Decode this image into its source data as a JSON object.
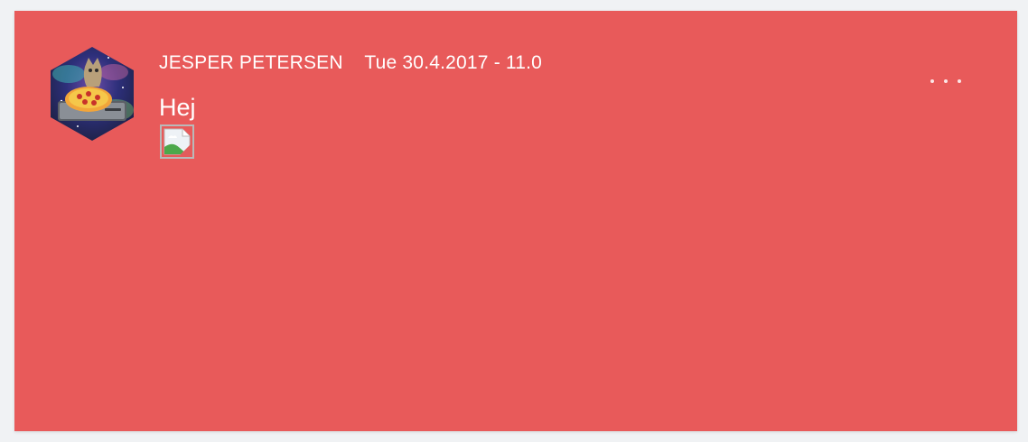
{
  "post": {
    "author": "JESPER PETERSEN",
    "timestamp": "Tue 30.4.2017 - 11.0",
    "text": "Hej",
    "avatar_icon": "cat-dj-pizza-avatar",
    "attachment_icon": "broken-image-icon",
    "more_icon": "more-options-icon"
  },
  "colors": {
    "card_background": "#e85a5a",
    "page_background": "#f0f2f4",
    "text": "#ffffff"
  }
}
